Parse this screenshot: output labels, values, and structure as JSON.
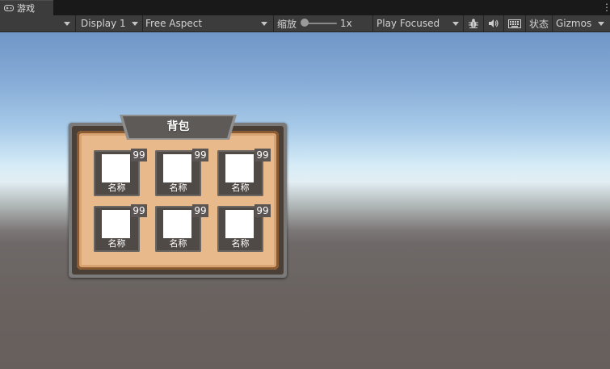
{
  "tab": {
    "title": "游戏",
    "icon": "gamepad-icon"
  },
  "toolbar": {
    "display": "Display 1",
    "aspect": "Free Aspect",
    "scale_label": "缩放",
    "scale_value": "1x",
    "scale_level": 0.0,
    "play_mode": "Play Focused",
    "stats": "状态",
    "gizmos": "Gizmos",
    "icons": [
      "bug-icon",
      "speaker-icon",
      "keyboard-icon"
    ]
  },
  "inventory": {
    "title": "背包",
    "slots": [
      {
        "count": "99",
        "name": "名称"
      },
      {
        "count": "99",
        "name": "名称"
      },
      {
        "count": "99",
        "name": "名称"
      },
      {
        "count": "99",
        "name": "名称"
      },
      {
        "count": "99",
        "name": "名称"
      },
      {
        "count": "99",
        "name": "名称"
      }
    ]
  },
  "colors": {
    "toolbar_bg": "#3c3c3c",
    "parchment": "#e8b98a",
    "slot_bg": "#504a47",
    "sky_top": "#6f96c7",
    "ground": "#675f5c"
  }
}
